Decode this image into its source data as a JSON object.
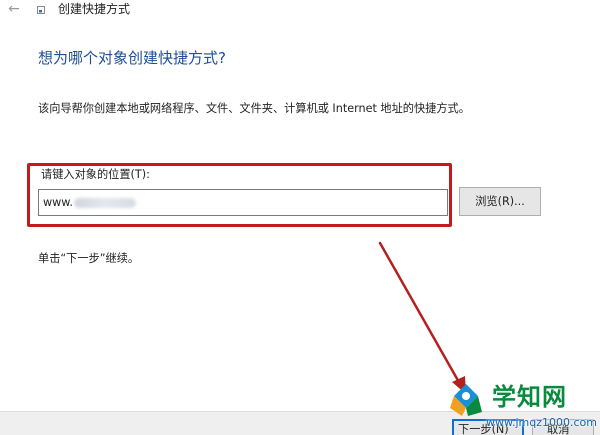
{
  "window": {
    "title": "创建快捷方式"
  },
  "wizard": {
    "heading": "想为哪个对象创建快捷方式?",
    "description": "该向导帮你创建本地或网络程序、文件、文件夹、计算机或 Internet 地址的快捷方式。",
    "location_label": "请键入对象的位置(T):",
    "location_value": "www.",
    "browse_label": "浏览(R)...",
    "hint": "单击“下一步”继续。"
  },
  "footer": {
    "next_label": "下一步(N)",
    "cancel_label": "取消"
  },
  "watermark": {
    "name": "学知网",
    "url": "www.jmqz1000.com"
  },
  "colors": {
    "heading": "#1f4e96",
    "highlight_box": "#c61a1a",
    "annotation_arrow": "#b3211f",
    "primary_button_border": "#0f6fd0",
    "watermark_green": "#0a8a3e",
    "watermark_blue": "#1a63a8"
  },
  "icons": {
    "back": "back-arrow-icon",
    "app": "shortcut-app-icon",
    "watermark_logo": "watermark-logo-icon"
  }
}
